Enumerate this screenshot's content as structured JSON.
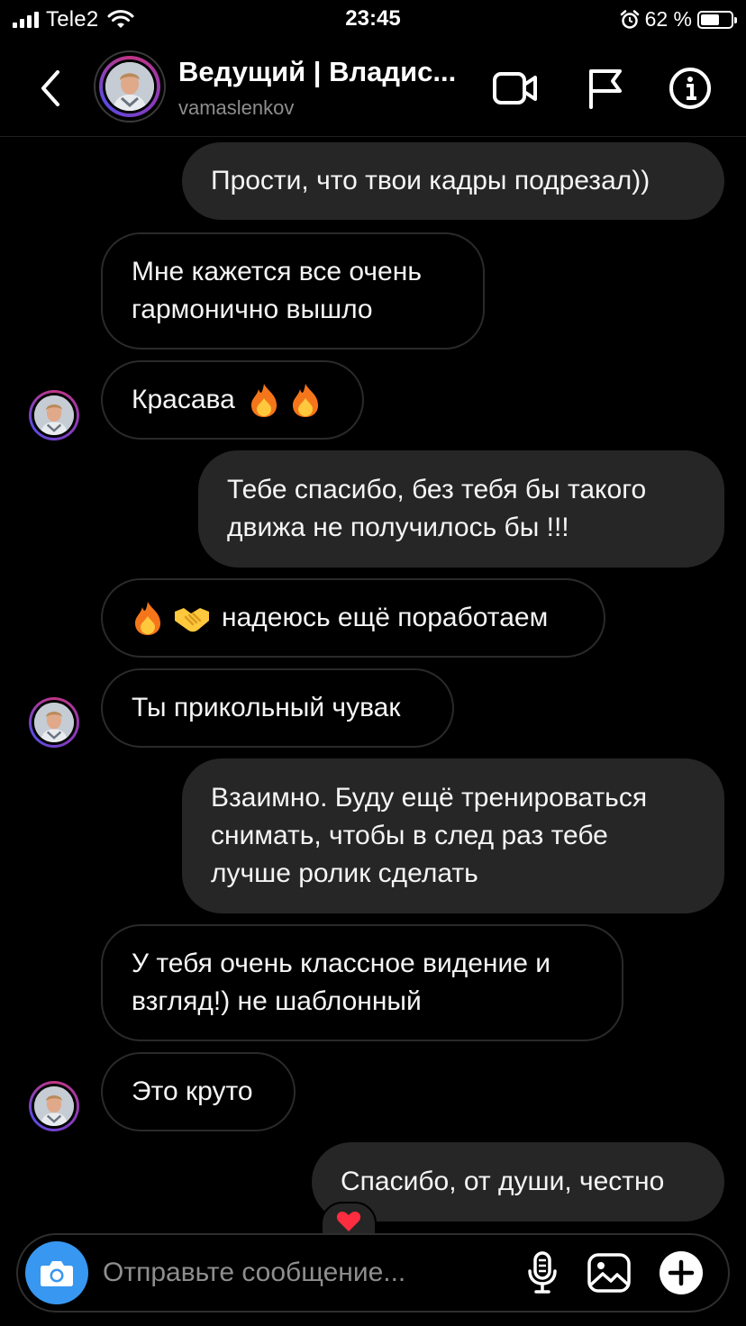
{
  "status_bar": {
    "carrier": "Tele2",
    "time": "23:45",
    "battery_percent": "62 %",
    "battery_level": 0.62
  },
  "header": {
    "name": "Ведущий | Владис...",
    "username": "vamaslenkov",
    "icons": [
      "back-icon",
      "video-call-icon",
      "flag-icon",
      "info-icon"
    ]
  },
  "messages": [
    {
      "direction": "sent",
      "text": "Прости, что твои кадры подрезал))"
    },
    {
      "direction": "received",
      "text": "Мне кажется все очень\nгармонично вышло"
    },
    {
      "direction": "received",
      "text": "Красава",
      "emoji": [
        "fire",
        "fire"
      ]
    },
    {
      "direction": "sent",
      "text": "Тебе спасибо, без тебя бы такого\nдвижа не получилось бы !!!"
    },
    {
      "direction": "received",
      "text": "надеюсь ещё поработаем",
      "emoji_prefix": [
        "fire",
        "handshake"
      ]
    },
    {
      "direction": "received",
      "text": "Ты прикольный чувак"
    },
    {
      "direction": "sent",
      "text": "Взаимно. Буду ещё тренироваться\nснимать, чтобы в след раз тебе\nлучше ролик сделать"
    },
    {
      "direction": "received",
      "text": "У тебя очень классное видение и\nвзгляд!) не шаблонный"
    },
    {
      "direction": "received",
      "text": "Это круто"
    },
    {
      "direction": "sent",
      "text": "Спасибо, от души, честно",
      "reaction": "heart"
    }
  ],
  "composer": {
    "placeholder": "Отправьте сообщение...",
    "icons": [
      "camera-icon",
      "microphone-icon",
      "gallery-icon",
      "plus-icon"
    ]
  },
  "colors": {
    "background": "#000000",
    "sent_bubble": "#262626",
    "received_border": "#2a2a2a",
    "camera_button": "#3897f0",
    "story_ring": "#c13584"
  }
}
